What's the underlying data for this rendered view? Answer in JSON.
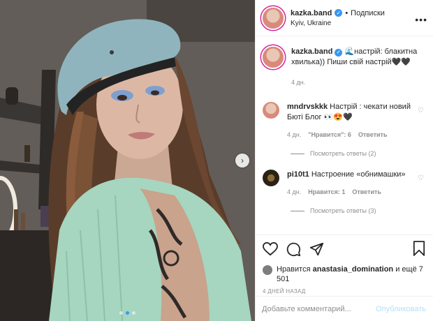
{
  "header": {
    "username": "kazka.band",
    "verified_glyph": "✓",
    "separator": "•",
    "follow_label": "Подписки",
    "location": "Kyiv, Ukraine",
    "more_glyph": "•••"
  },
  "caption": {
    "username": "kazka.band",
    "text": "🌊настрій: блакитна хвилька)) Пиши свій настрій🖤🖤",
    "age": "4 дн."
  },
  "comments": [
    {
      "username": "mndrvskkk",
      "text": "Настрій : чекати новий Бюті Блог 👀😍🖤",
      "age": "4 дн.",
      "likes": "\"Нравится\": 6",
      "reply_label": "Ответить",
      "view_replies": "Посмотреть ответы (2)"
    },
    {
      "username": "pi10t1",
      "text": "Настроение «обнимашки»",
      "age": "4 дн.",
      "likes": "Нравится: 1",
      "reply_label": "Ответить",
      "view_replies": "Посмотреть ответы (3)"
    }
  ],
  "likes": {
    "prefix": "Нравится",
    "user": "anastasia_domination",
    "suffix": "и ещё 7 501"
  },
  "timestamp": "4 ДНЕЙ НАЗАД",
  "add_comment": {
    "placeholder": "Добавьте комментарий...",
    "publish_label": "Опубликовать"
  },
  "carousel": {
    "next_glyph": "›",
    "total": 3,
    "active_index": 1
  },
  "colors": {
    "accent": "#3897f0",
    "publish_disabled": "#b2dffc",
    "muted": "#8e8e8e"
  },
  "icons": [
    "heart-icon",
    "comment-icon",
    "share-icon",
    "bookmark-icon",
    "more-icon",
    "verified-icon",
    "chevron-right-icon"
  ]
}
